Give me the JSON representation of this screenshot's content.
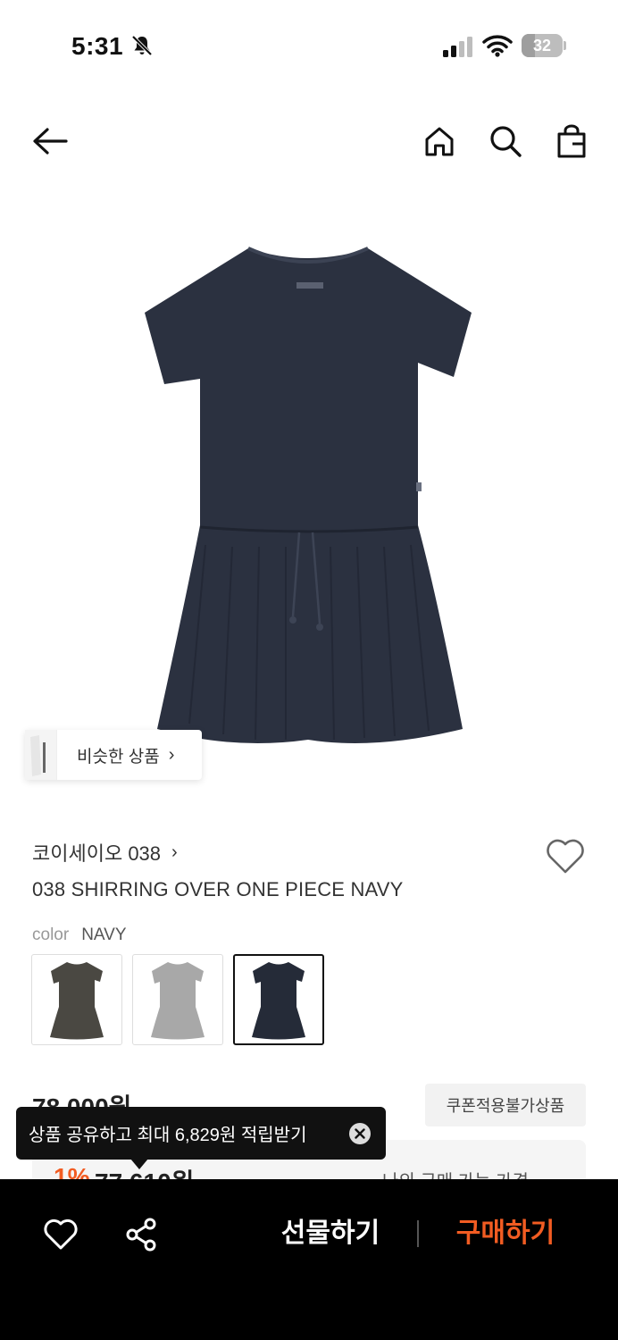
{
  "status_bar": {
    "time": "5:31",
    "battery_level": "32",
    "battery_fraction": 0.32
  },
  "nav": {
    "back_icon": "arrow-left-icon",
    "home_icon": "home-icon",
    "search_icon": "search-icon",
    "bag_icon": "shopping-bag-icon"
  },
  "product": {
    "similar_label": "비슷한 상품",
    "similar_chevron": "›",
    "brand": "코이세이오 038",
    "brand_chevron": "›",
    "title": "038 SHIRRING OVER ONE PIECE NAVY",
    "option_key": "color",
    "option_value": "NAVY",
    "swatch_colors": [
      "#4a4842",
      "#a8a8a8",
      "#252b38"
    ],
    "selected_swatch": 2,
    "dress_color": "#2b3140",
    "price": "78,000원",
    "coupon_badge": "쿠폰적용불가상품",
    "discount_rate": "1%",
    "discount_price": "77,610원",
    "discount_link": "나의 구매 가능 가격"
  },
  "toast": {
    "text": "상품 공유하고 최대 6,829원 적립받기"
  },
  "bottom_bar": {
    "gift_label": "선물하기",
    "buy_label": "구매하기",
    "accent_color": "#f25c22"
  }
}
